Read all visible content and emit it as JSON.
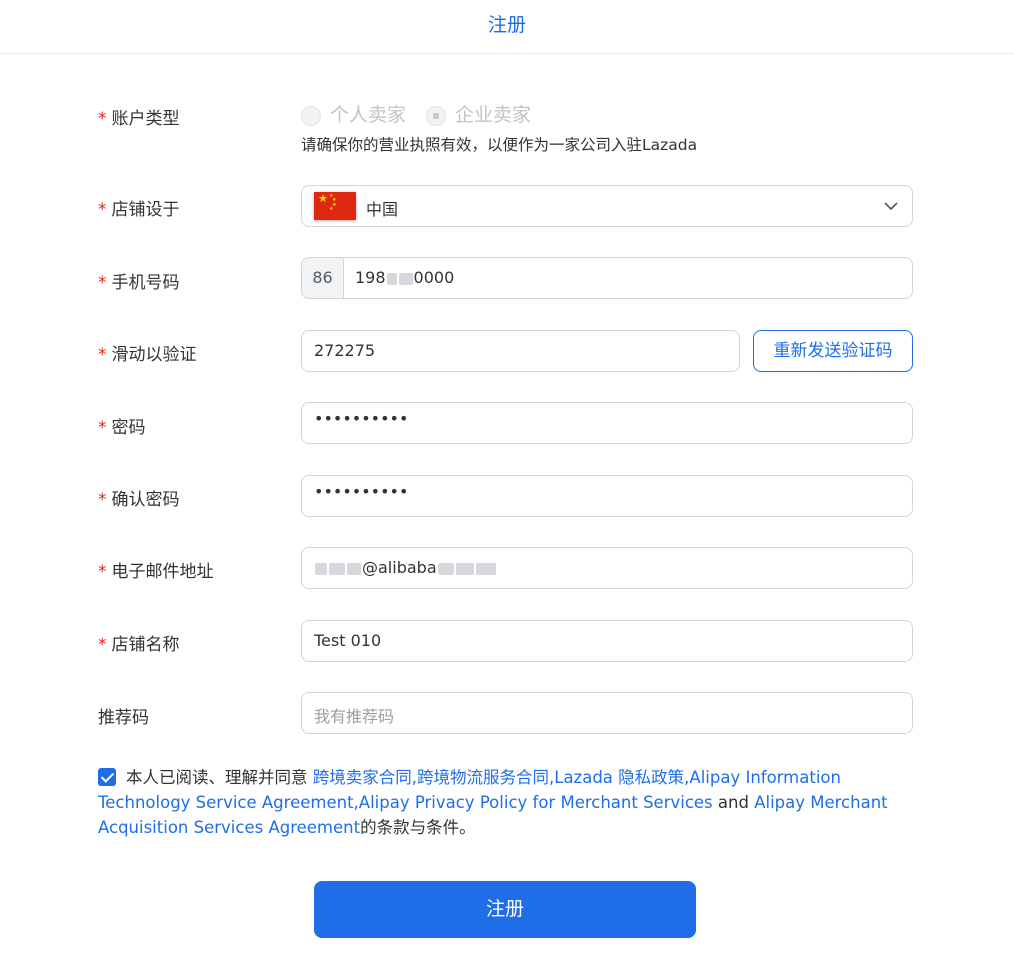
{
  "header": {
    "title": "注册"
  },
  "form": {
    "account_type": {
      "label": "账户类型",
      "options": [
        "个人卖家",
        "企业卖家"
      ],
      "selected": "企业卖家",
      "hint": "请确保你的营业执照有效，以便作为一家公司入驻Lazada"
    },
    "store_location": {
      "label": "店铺设于",
      "value": "中国",
      "flag": "china-flag"
    },
    "phone": {
      "label": "手机号码",
      "prefix": "86",
      "value_start": "198",
      "value_end": "0000"
    },
    "verify": {
      "label": "滑动以验证",
      "value": "272275",
      "resend_label": "重新发送验证码"
    },
    "password": {
      "label": "密码",
      "value": "••••••••••"
    },
    "confirm_password": {
      "label": "确认密码",
      "value": "••••••••••"
    },
    "email": {
      "label": "电子邮件地址",
      "value_domain": "@alibaba"
    },
    "store_name": {
      "label": "店铺名称",
      "value": "Test 010"
    },
    "referral": {
      "label": "推荐码",
      "placeholder": "我有推荐码"
    }
  },
  "agreement": {
    "checked": true,
    "prefix": "本人已阅读、理解并同意",
    "links": [
      "跨境卖家合同,",
      "跨境物流服务合同,",
      "Lazada 隐私政策,",
      "Alipay Information Technology Service Agreement,",
      "Alipay Privacy Policy for Merchant Services",
      "Alipay Merchant Acquisition Services Agreement"
    ],
    "and_text": "and",
    "suffix": "的条款与条件。"
  },
  "submit_label": "注册",
  "colors": {
    "accent": "#1f6ee8",
    "required": "#e5261f"
  }
}
